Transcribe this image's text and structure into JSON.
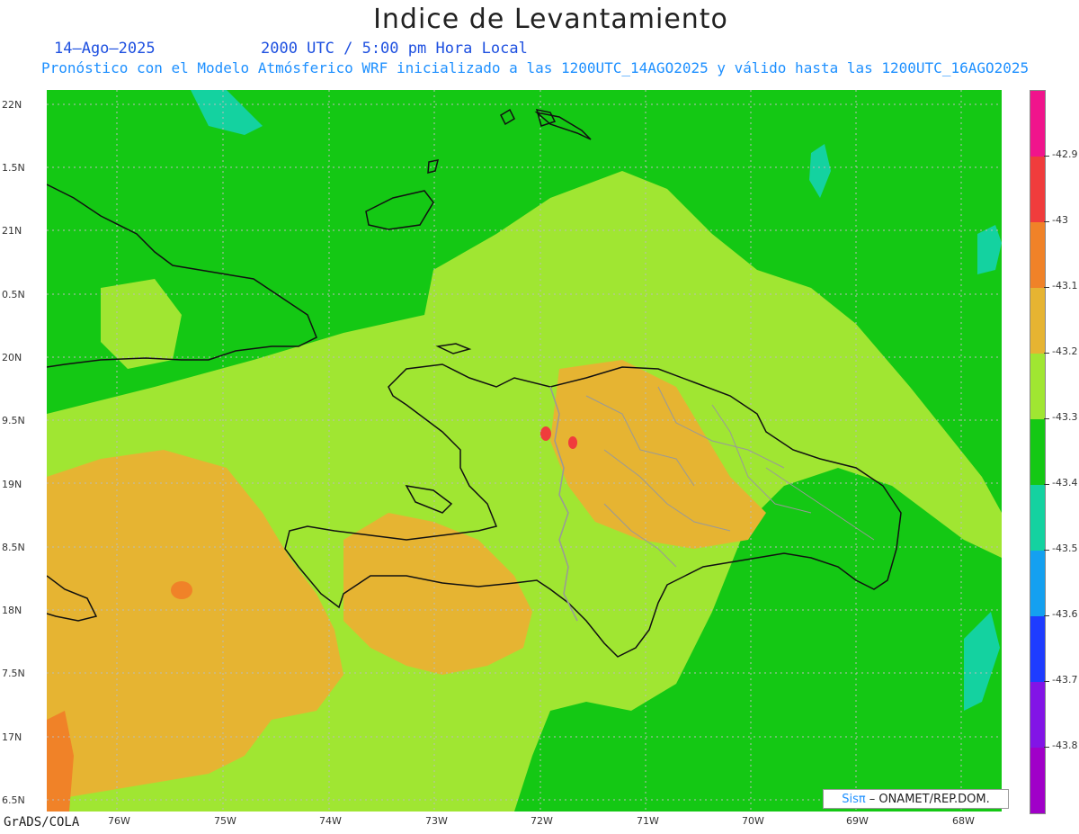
{
  "title": "Indice de Levantamiento",
  "date": "14–Ago–2025",
  "time": "2000 UTC / 5:00 pm Hora Local",
  "subtitle": "Pronóstico con el Modelo Atmósferico WRF inicializado a las 1200UTC_14AGO2025 y válido hasta las  1200UTC_16AGO2025",
  "credit": "GrADS/COLA",
  "attribution": {
    "sis": "Sisπ",
    "rest": "– ONAMET/REP.DOM."
  },
  "lat_labels": [
    "22N",
    "1.5N",
    "21N",
    "0.5N",
    "20N",
    "9.5N",
    "19N",
    "8.5N",
    "18N",
    "7.5N",
    "17N",
    "6.5N"
  ],
  "lon_labels": [
    "76W",
    "75W",
    "74W",
    "73W",
    "72W",
    "71W",
    "70W",
    "69W",
    "68W"
  ],
  "colorbar": {
    "labels": [
      "-42.9",
      "-43",
      "-43.1",
      "-43.2",
      "-43.3",
      "-43.4",
      "-43.5",
      "-43.6",
      "-43.7",
      "-43.8"
    ],
    "colors": [
      "#f0148c",
      "#f03c3c",
      "#f08228",
      "#e6b432",
      "#a0e632",
      "#14c814",
      "#14d2a0",
      "#14a0f0",
      "#1e3cff",
      "#8214e6",
      "#a000c8"
    ]
  },
  "field_colors": {
    "deep_green": "#14c814",
    "light_green": "#a0e632",
    "orange": "#e6b432",
    "dark_orange": "#f08228",
    "teal": "#14d2a0",
    "red": "#f03c3c"
  }
}
